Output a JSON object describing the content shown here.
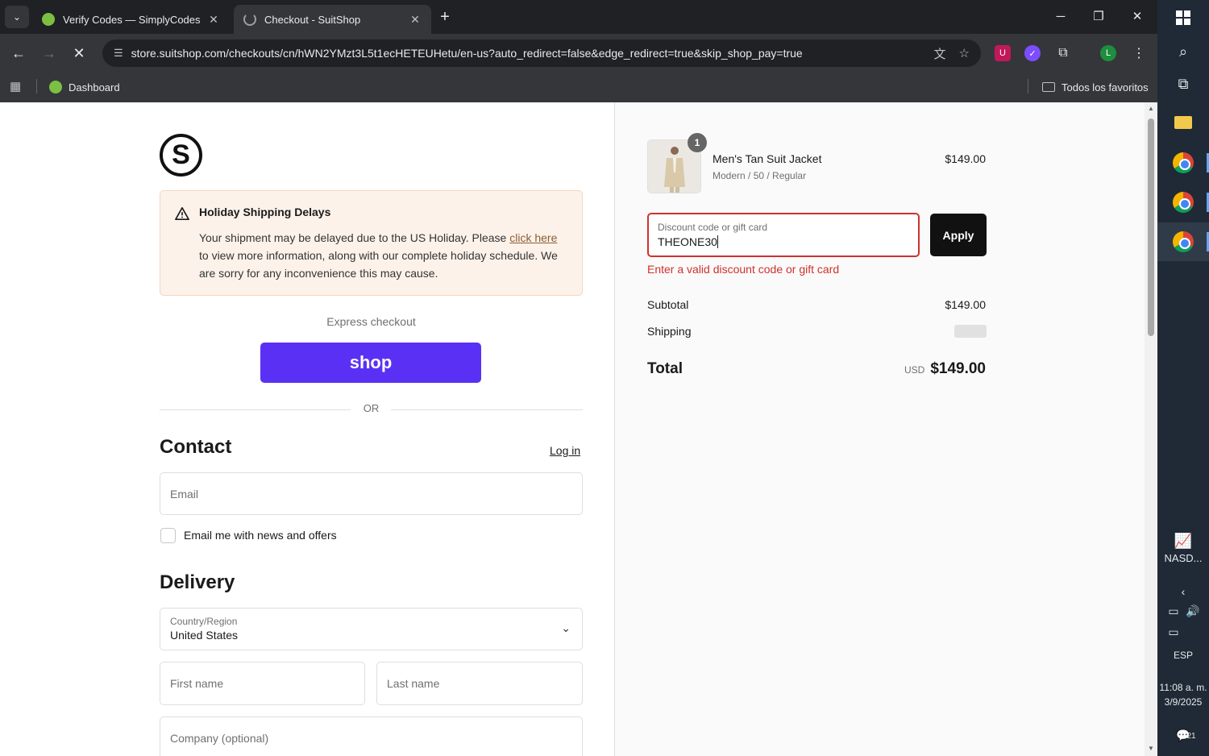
{
  "browser": {
    "tabs": [
      {
        "title": "Verify Codes — SimplyCodes",
        "active": false
      },
      {
        "title": "Checkout - SuitShop",
        "active": true
      }
    ],
    "url": "store.suitshop.com/checkouts/cn/hWN2YMzt3L5t1ecHETEUHetu/en-us?auto_redirect=false&edge_redirect=true&skip_shop_pay=true",
    "bookmarks": {
      "dashboard_label": "Dashboard",
      "all_bookmarks_label": "Todos los favoritos"
    },
    "profile_initial": "L"
  },
  "checkout": {
    "logo_letter": "S",
    "notice": {
      "title": "Holiday Shipping Delays",
      "body_before": "Your shipment may be delayed due to the US Holiday. Please ",
      "link_text": "click here",
      "body_after": " to view more information, along with our complete holiday schedule. We are sorry for any inconvenience this may cause."
    },
    "express_label": "Express checkout",
    "shop_button_label": "shop",
    "or_label": "OR",
    "contact": {
      "heading": "Contact",
      "login_label": "Log in",
      "email_placeholder": "Email",
      "newsletter_label": "Email me with news and offers"
    },
    "delivery": {
      "heading": "Delivery",
      "country_label": "Country/Region",
      "country_value": "United States",
      "first_name_placeholder": "First name",
      "last_name_placeholder": "Last name",
      "company_placeholder": "Company (optional)"
    }
  },
  "summary": {
    "product": {
      "quantity": "1",
      "name": "Men's Tan Suit Jacket",
      "variant": "Modern / 50 / Regular",
      "price": "$149.00"
    },
    "discount": {
      "label": "Discount code or gift card",
      "value": "THEONE30",
      "apply_label": "Apply",
      "error": "Enter a valid discount code or gift card"
    },
    "subtotal_label": "Subtotal",
    "subtotal_value": "$149.00",
    "shipping_label": "Shipping",
    "total_label": "Total",
    "total_currency": "USD",
    "total_value": "$149.00"
  },
  "taskbar": {
    "nasdaq_label": "NASD...",
    "language": "ESP",
    "time": "11:08 a. m.",
    "date": "3/9/2025",
    "notifications": "21"
  },
  "colors": {
    "shop_purple": "#5a31f4",
    "error_red": "#d0312d",
    "notice_bg": "#fdf2ea"
  }
}
